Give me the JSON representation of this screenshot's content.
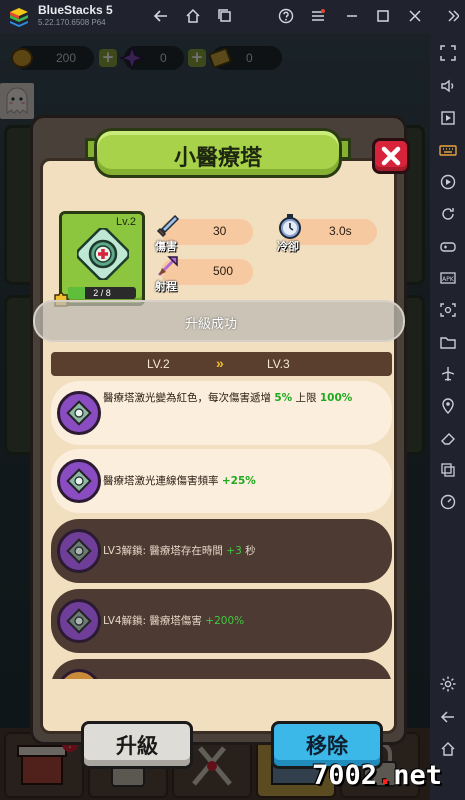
{
  "window": {
    "app_name": "BlueStacks 5",
    "version": "5.22.170.6508  P64"
  },
  "resources": {
    "gold": "200",
    "gem": "0",
    "ticket": "0"
  },
  "dialog": {
    "title": "小醫療塔",
    "tower_level": "Lv.2",
    "progress_text": "2 / 8",
    "progress_fraction": 0.25,
    "stats": [
      {
        "label": "傷害",
        "value": "30",
        "icon": "sword-icon"
      },
      {
        "label": "冷卻",
        "value": "3.0s",
        "icon": "stopwatch-icon"
      },
      {
        "label": "射程",
        "value": "500",
        "icon": "range-icon"
      }
    ],
    "toast": "升級成功",
    "level_from": "LV.2",
    "level_arrow": "»",
    "level_to": "LV.3",
    "upgrades": [
      {
        "text": "醫療塔激光變為紅色，每次傷害遞增 ",
        "highlight": "5%",
        "suffix": " 上限 ",
        "highlight2": "100%",
        "unlocked": true
      },
      {
        "text": "醫療塔激光連線傷害頻率 ",
        "highlight": "+25%",
        "suffix": "",
        "highlight2": "",
        "unlocked": true
      },
      {
        "text": "LV3解鎖: 醫療塔存在時間 ",
        "highlight": "+3",
        "suffix": " 秒",
        "highlight2": "",
        "unlocked": false
      },
      {
        "text": "LV4解鎖: 醫療塔傷害 ",
        "highlight": "+200%",
        "suffix": "",
        "highlight2": "",
        "unlocked": false
      }
    ],
    "upgrade_button": "升級",
    "remove_button": "移除"
  },
  "watermark": {
    "main": "7002",
    "dot": ".",
    "net": "net"
  },
  "colors": {
    "title_green": "#a7d24a",
    "close_red": "#d8243a",
    "remove_blue": "#3bb7e8",
    "highlight_green": "#1fa91f"
  }
}
